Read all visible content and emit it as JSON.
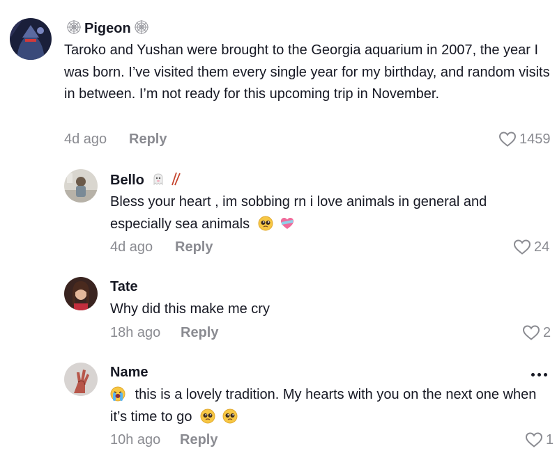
{
  "comments": [
    {
      "username": "Pigeon",
      "username_prefix_icon": "spider-web-icon",
      "username_suffix_icon": "spider-web-icon",
      "text": "Taroko and Yushan were brought to the Georgia aquarium in 2007, the year I was born. I’ve visited them every single year for my birthday, and random visits in between. I’m not ready for this upcoming trip in November.",
      "time": "4d ago",
      "reply_label": "Reply",
      "likes": "1459"
    },
    {
      "username": "Bello",
      "username_icons": [
        "ghost-icon",
        "chopsticks-icon"
      ],
      "text": "Bless your heart , im sobbing rn i love animals in general and especially sea animals",
      "text_emojis": [
        "pleading-face-emoji",
        "heart-with-ribbon-emoji"
      ],
      "time": "4d ago",
      "reply_label": "Reply",
      "likes": "24"
    },
    {
      "username": "Tate",
      "text": "Why did this make me cry",
      "time": "18h ago",
      "reply_label": "Reply",
      "likes": "2"
    },
    {
      "username": "Name",
      "text_prefix_emoji": "crying-face-emoji",
      "text": "this is a lovely tradition. My hearts with you on the next one when it’s time to go",
      "text_emojis": [
        "pleading-face-emoji",
        "pleading-face-emoji"
      ],
      "time": "10h ago",
      "reply_label": "Reply",
      "likes": "1",
      "more_icon": "more-options-icon"
    }
  ]
}
